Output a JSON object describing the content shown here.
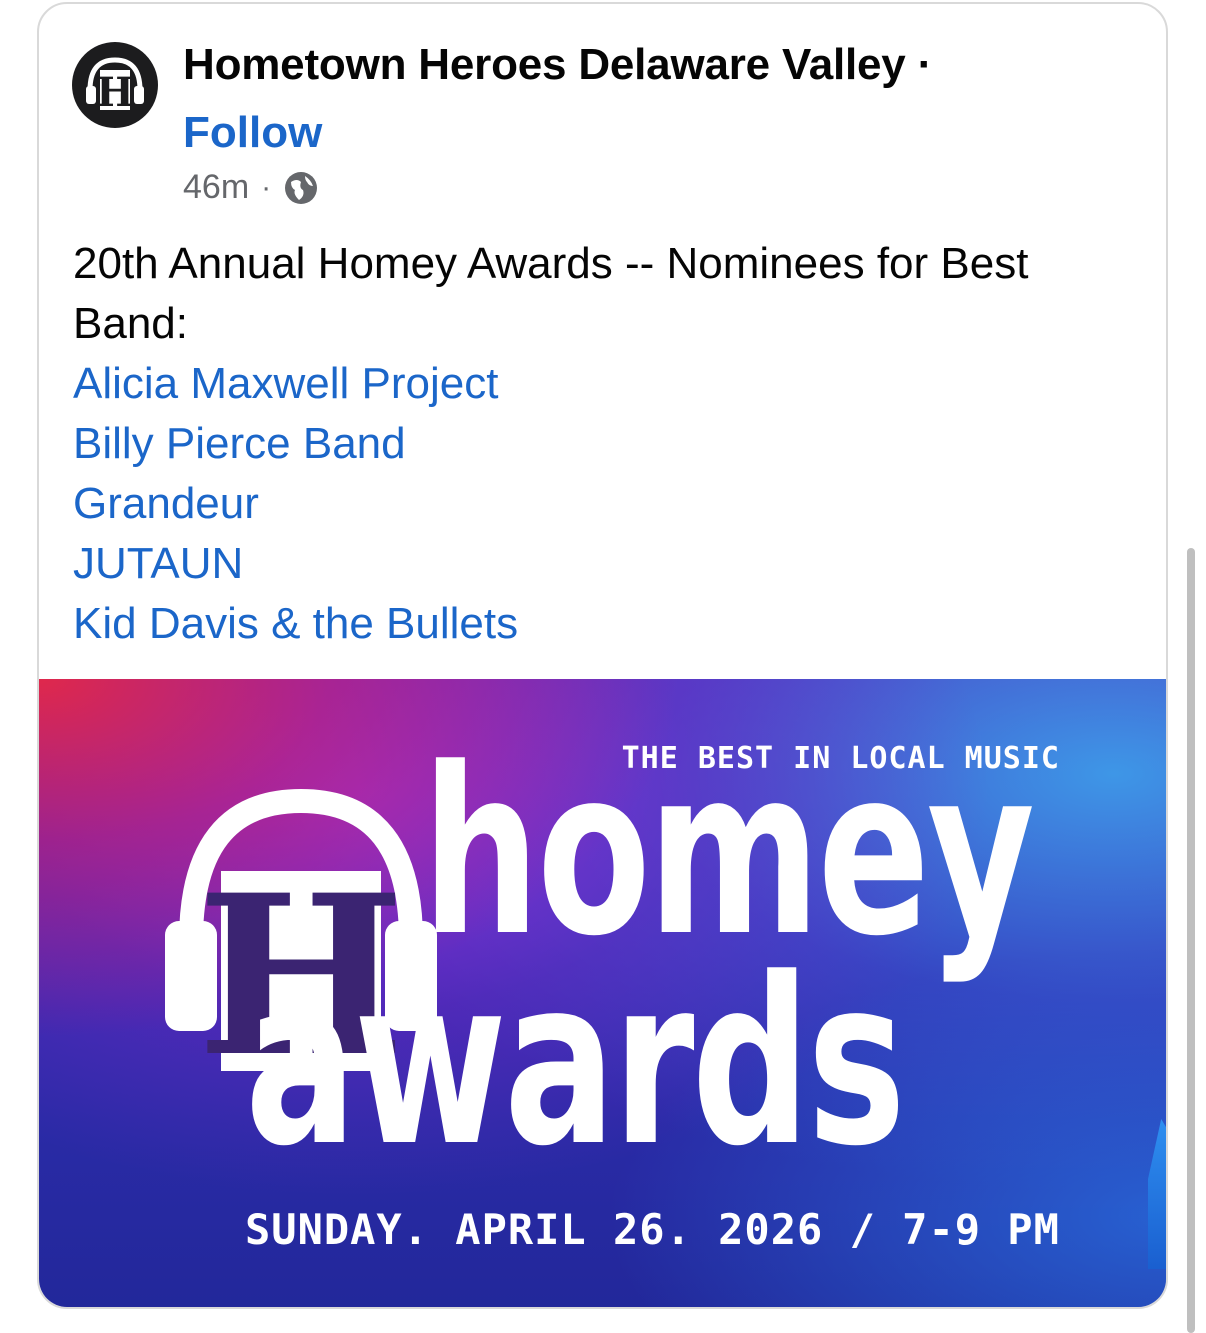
{
  "post": {
    "page_name": "Hometown Heroes Delaware Valley",
    "name_separator": "·",
    "follow_label": "Follow",
    "time": "46m",
    "meta_separator": "·",
    "audience_icon": "globe-icon",
    "text_line": "20th Annual Homey Awards -- Nominees for Best Band:",
    "nominees": [
      "Alicia Maxwell Project",
      "Billy Pierce Band",
      "Grandeur",
      "JUTAUN",
      "Kid Davis & the Bullets"
    ]
  },
  "avatar": {
    "icon": "headphones-h-logo-icon",
    "letter": "H"
  },
  "banner": {
    "tagline": "THE BEST IN LOCAL MUSIC",
    "logo_letter": "H",
    "word_homey": "homey",
    "word_awards": "awards",
    "date_line": "SUNDAY. APRIL 26. 2026 / 7-9 PM"
  },
  "colors": {
    "link": "#1b66c9",
    "text": "#050505",
    "meta": "#65676b",
    "banner_purple": "#3a2ab2",
    "logo_purple": "#3b2472"
  }
}
